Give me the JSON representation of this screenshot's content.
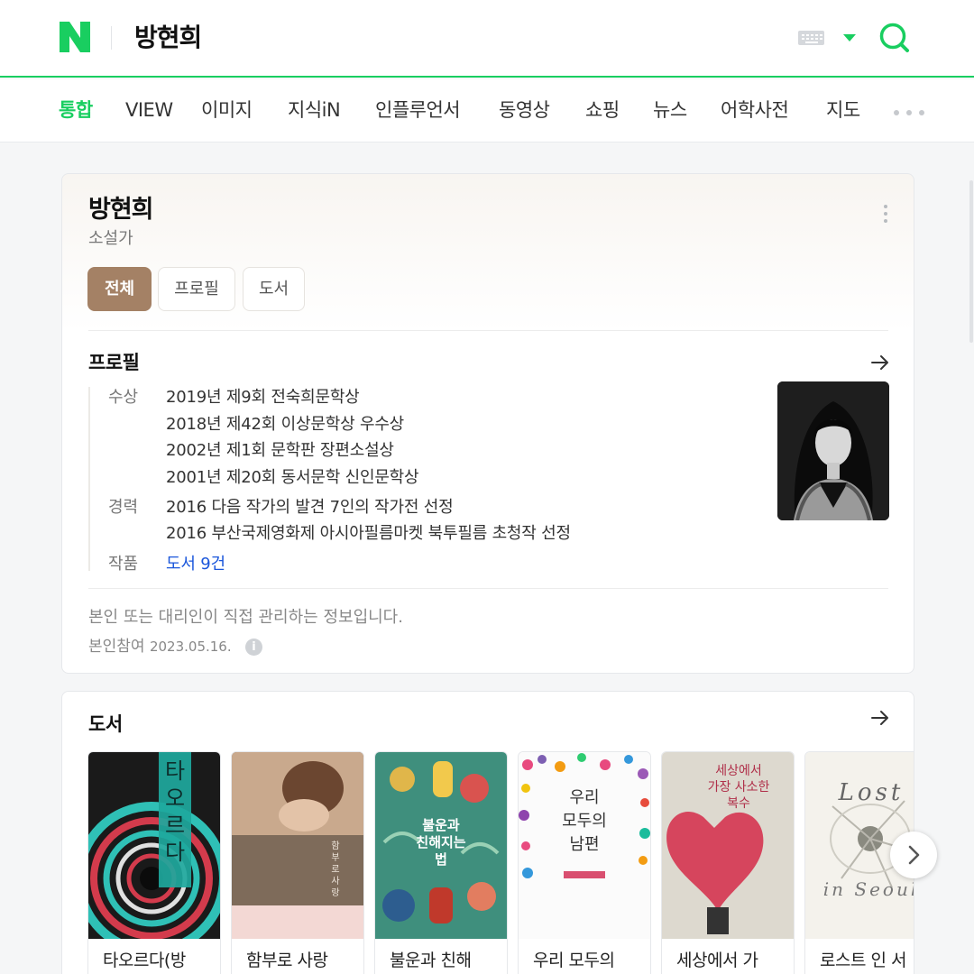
{
  "header": {
    "logo_letter": "N",
    "query": "방현희",
    "brand_color": "#19ce60"
  },
  "tabs": [
    {
      "label": "통합",
      "active": true
    },
    {
      "label": "VIEW"
    },
    {
      "label": "이미지"
    },
    {
      "label": "지식iN"
    },
    {
      "label": "인플루언서"
    },
    {
      "label": "동영상"
    },
    {
      "label": "쇼핑"
    },
    {
      "label": "뉴스"
    },
    {
      "label": "어학사전"
    },
    {
      "label": "지도"
    }
  ],
  "profile": {
    "name": "방현희",
    "job": "소설가",
    "chips": [
      "전체",
      "프로필",
      "도서"
    ],
    "section_title": "프로필",
    "awards_label": "수상",
    "awards": [
      "2019년 제9회 전숙희문학상",
      "2018년 제42회 이상문학상 우수상",
      "2002년 제1회 문학판 장편소설상",
      "2001년 제20회 동서문학 신인문학상"
    ],
    "career_label": "경력",
    "career": [
      "2016 다음 작가의 발견 7인의 작가전 선정",
      "2016 부산국제영화제 아시아필름마켓 북투필름 초청작 선정"
    ],
    "works_label": "작품",
    "works_link": "도서 9건",
    "managed_note": "본인 또는 대리인이 직접 관리하는 정보입니다.",
    "selfref_label": "본인참여",
    "selfref_date": "2023.05.16."
  },
  "books": {
    "section_title": "도서",
    "items": [
      {
        "title": "타오르다(방",
        "cover_text": "타오르다"
      },
      {
        "title": "함부로 사랑",
        "cover_text": "함부로 사랑을 말하지 않았다"
      },
      {
        "title": "불운과 친해",
        "cover_text": "불운과 친해지는 법"
      },
      {
        "title": "우리 모두의",
        "cover_text": "우리 모두의 남편"
      },
      {
        "title": "세상에서 가",
        "cover_text": "세상에서 가장 사소한 복수"
      },
      {
        "title": "로스트 인 서",
        "cover_text": "Lost in Seoul"
      }
    ]
  },
  "icons": {
    "keyboard": "keyboard-icon",
    "dropdown": "caret-down-icon",
    "search": "search-icon",
    "more_tabs": "ellipsis-icon",
    "more_menu": "vertical-ellipsis-icon",
    "arrow": "arrow-right-icon",
    "info": "info-icon",
    "next": "chevron-right-icon"
  }
}
